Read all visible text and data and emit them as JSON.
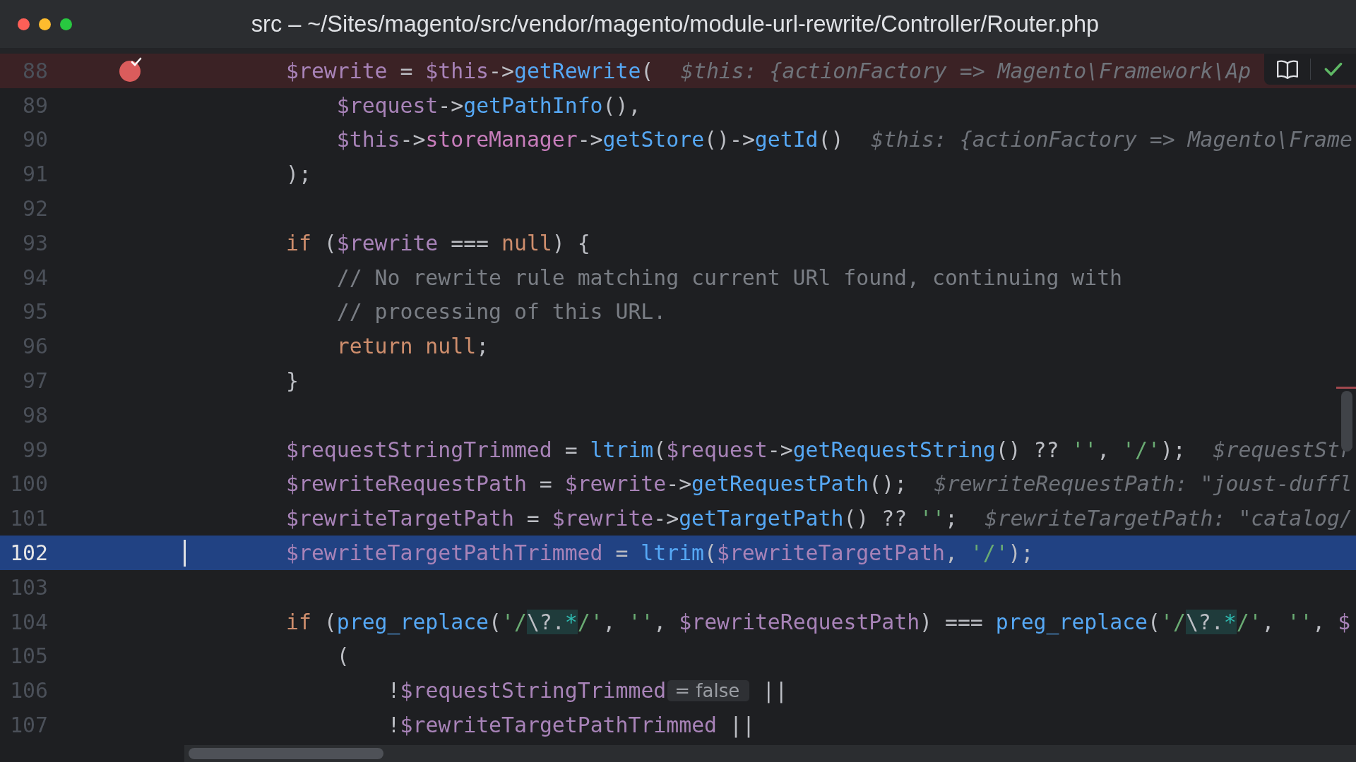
{
  "window": {
    "title": "src – ~/Sites/magento/src/vendor/magento/module-url-rewrite/Controller/Router.php"
  },
  "editor": {
    "lines": [
      {
        "num": "88",
        "breakpoint": true,
        "selected": false,
        "tokens": [
          {
            "t": "$rewrite",
            "kind": "var"
          },
          {
            "t": " = ",
            "kind": "plain"
          },
          {
            "t": "$this",
            "kind": "var"
          },
          {
            "t": "->",
            "kind": "plain"
          },
          {
            "t": "getRewrite",
            "kind": "fn"
          },
          {
            "t": "(",
            "kind": "plain"
          },
          {
            "t": "$this: {actionFactory => Magento\\Framework\\Ap",
            "kind": "hint"
          }
        ],
        "children": [
          {
            "num": "89",
            "breakpoint": false,
            "selected": false,
            "tokens": [
              {
                "t": "$request",
                "kind": "var"
              },
              {
                "t": "->",
                "kind": "plain"
              },
              {
                "t": "getPathInfo",
                "kind": "fn"
              },
              {
                "t": "(),",
                "kind": "plain"
              }
            ]
          },
          {
            "num": "90",
            "breakpoint": false,
            "selected": false,
            "tokens": [
              {
                "t": "$this",
                "kind": "var"
              },
              {
                "t": "->",
                "kind": "plain"
              },
              {
                "t": "storeManager",
                "kind": "member"
              },
              {
                "t": "->",
                "kind": "plain"
              },
              {
                "t": "getStore",
                "kind": "fn"
              },
              {
                "t": "()->",
                "kind": "plain"
              },
              {
                "t": "getId",
                "kind": "fn"
              },
              {
                "t": "()",
                "kind": "plain"
              },
              {
                "t": "$this: {actionFactory => Magento\\Frame",
                "kind": "hint"
              }
            ]
          }
        ]
      },
      {
        "num": "91",
        "breakpoint": false,
        "selected": false,
        "tokens": [
          {
            "t": ");",
            "kind": "plain"
          }
        ]
      },
      {
        "num": "92",
        "breakpoint": false,
        "selected": false
      },
      {
        "num": "93",
        "breakpoint": false,
        "selected": false,
        "tokens": [
          {
            "t": "if",
            "kind": "keyword"
          },
          {
            "t": " (",
            "kind": "plain"
          },
          {
            "t": "$rewrite",
            "kind": "var"
          },
          {
            "t": " === ",
            "kind": "plain"
          },
          {
            "t": "null",
            "kind": "keyword"
          },
          {
            "t": ") {",
            "kind": "plain"
          }
        ],
        "children": [
          {
            "num": "94",
            "breakpoint": false,
            "selected": false,
            "tokens": [
              {
                "t": "// No rewrite rule matching current URl found, continuing with",
                "kind": "comment"
              }
            ]
          },
          {
            "num": "95",
            "breakpoint": false,
            "selected": false,
            "tokens": [
              {
                "t": "// processing of this URL.",
                "kind": "comment"
              }
            ]
          },
          {
            "num": "96",
            "breakpoint": false,
            "selected": false,
            "tokens": [
              {
                "t": "return null",
                "kind": "keyword"
              },
              {
                "t": ";",
                "kind": "plain"
              }
            ]
          }
        ]
      },
      {
        "num": "97",
        "breakpoint": false,
        "selected": false,
        "tokens": [
          {
            "t": "}",
            "kind": "plain"
          }
        ]
      },
      {
        "num": "98",
        "breakpoint": false,
        "selected": false
      },
      {
        "num": "99",
        "breakpoint": false,
        "selected": false,
        "tokens": [
          {
            "t": "$requestStringTrimmed",
            "kind": "var"
          },
          {
            "t": " = ",
            "kind": "plain"
          },
          {
            "t": "ltrim",
            "kind": "fn"
          },
          {
            "t": "(",
            "kind": "plain"
          },
          {
            "t": "$request",
            "kind": "var"
          },
          {
            "t": "->",
            "kind": "plain"
          },
          {
            "t": "getRequestString",
            "kind": "fn"
          },
          {
            "t": "() ?? ",
            "kind": "plain"
          },
          {
            "t": "''",
            "kind": "string"
          },
          {
            "t": ", ",
            "kind": "plain"
          },
          {
            "t": "'/'",
            "kind": "string"
          },
          {
            "t": ");",
            "kind": "plain"
          },
          {
            "t": "$requestStr",
            "kind": "hint"
          }
        ]
      },
      {
        "num": "100",
        "breakpoint": false,
        "selected": false,
        "tokens": [
          {
            "t": "$rewriteRequestPath",
            "kind": "var"
          },
          {
            "t": " = ",
            "kind": "plain"
          },
          {
            "t": "$rewrite",
            "kind": "var"
          },
          {
            "t": "->",
            "kind": "plain"
          },
          {
            "t": "getRequestPath",
            "kind": "fn"
          },
          {
            "t": "();",
            "kind": "plain"
          },
          {
            "t": "$rewriteRequestPath: \"joust-duffl",
            "kind": "hint"
          }
        ]
      },
      {
        "num": "101",
        "breakpoint": false,
        "selected": false,
        "tokens": [
          {
            "t": "$rewriteTargetPath",
            "kind": "var"
          },
          {
            "t": " = ",
            "kind": "plain"
          },
          {
            "t": "$rewrite",
            "kind": "var"
          },
          {
            "t": "->",
            "kind": "plain"
          },
          {
            "t": "getTargetPath",
            "kind": "fn"
          },
          {
            "t": "() ?? ",
            "kind": "plain"
          },
          {
            "t": "''",
            "kind": "string"
          },
          {
            "t": ";",
            "kind": "plain"
          },
          {
            "t": "$rewriteTargetPath: \"catalog/",
            "kind": "hint"
          }
        ]
      },
      {
        "num": "102",
        "breakpoint": false,
        "selected": true,
        "tokens": [
          {
            "t": "$rewriteTargetPathTrimmed",
            "kind": "var"
          },
          {
            "t": " = ",
            "kind": "plain"
          },
          {
            "t": "ltrim",
            "kind": "fn"
          },
          {
            "t": "(",
            "kind": "plain"
          },
          {
            "t": "$rewriteTargetPath",
            "kind": "var"
          },
          {
            "t": ", ",
            "kind": "plain"
          },
          {
            "t": "'/'",
            "kind": "string"
          },
          {
            "t": ");",
            "kind": "plain"
          }
        ]
      },
      {
        "num": "103",
        "breakpoint": false,
        "selected": false
      },
      {
        "num": "104",
        "breakpoint": false,
        "selected": false,
        "tokens": [
          {
            "t": "if",
            "kind": "keyword"
          },
          {
            "t": " (",
            "kind": "plain"
          },
          {
            "t": "preg_replace",
            "kind": "fn"
          },
          {
            "t": "(",
            "kind": "plain"
          },
          {
            "t": "'/",
            "kind": "string"
          },
          {
            "t": "\\?.",
            "kind": "regex"
          },
          {
            "t": "*",
            "kind": "regexop"
          },
          {
            "t": "/'",
            "kind": "string"
          },
          {
            "t": ", ",
            "kind": "plain"
          },
          {
            "t": "''",
            "kind": "string"
          },
          {
            "t": ", ",
            "kind": "plain"
          },
          {
            "t": "$rewriteRequestPath",
            "kind": "var"
          },
          {
            "t": ") === ",
            "kind": "plain"
          },
          {
            "t": "preg_replace",
            "kind": "fn"
          },
          {
            "t": "(",
            "kind": "plain"
          },
          {
            "t": "'/",
            "kind": "string"
          },
          {
            "t": "\\?.",
            "kind": "regex"
          },
          {
            "t": "*",
            "kind": "regexop"
          },
          {
            "t": "/'",
            "kind": "string"
          },
          {
            "t": ", ",
            "kind": "plain"
          },
          {
            "t": "''",
            "kind": "string"
          },
          {
            "t": ", ",
            "kind": "plain"
          },
          {
            "t": "$",
            "kind": "var"
          }
        ],
        "children": [
          {
            "num": "105",
            "breakpoint": false,
            "selected": false,
            "tokens": [
              {
                "t": "(",
                "kind": "plain"
              }
            ],
            "children": [
              {
                "num": "106",
                "breakpoint": false,
                "selected": false,
                "tokens": [
                  {
                    "t": "!",
                    "kind": "plain"
                  },
                  {
                    "t": "$requestStringTrimmed",
                    "kind": "var"
                  },
                  {
                    "t": "= false",
                    "kind": "badge"
                  },
                  {
                    "t": "||",
                    "kind": "plain"
                  }
                ]
              },
              {
                "num": "107",
                "breakpoint": false,
                "selected": false,
                "tokens": [
                  {
                    "t": "!",
                    "kind": "plain"
                  },
                  {
                    "t": "$rewriteTargetPathTrimmed",
                    "kind": "var"
                  },
                  {
                    "t": " ||",
                    "kind": "plain"
                  }
                ]
              }
            ]
          }
        ]
      }
    ]
  }
}
